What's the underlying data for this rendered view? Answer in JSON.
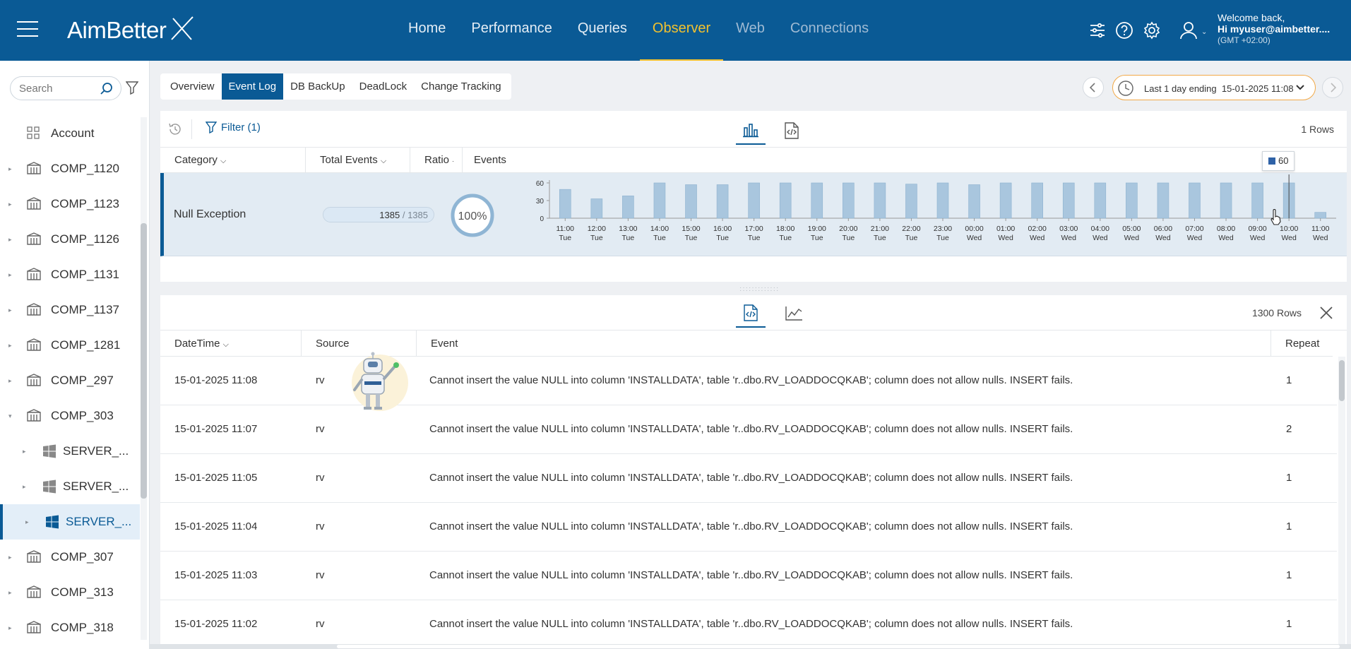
{
  "header": {
    "brand": "AimBetter",
    "nav": [
      {
        "label": "Home",
        "state": "normal"
      },
      {
        "label": "Performance",
        "state": "normal"
      },
      {
        "label": "Queries",
        "state": "normal"
      },
      {
        "label": "Observer",
        "state": "active"
      },
      {
        "label": "Web",
        "state": "dim"
      },
      {
        "label": "Connections",
        "state": "dim"
      }
    ],
    "user": {
      "welcome": "Welcome back,",
      "name": "Hi myuser@aimbetter....",
      "timezone": "(GMT +02:00)"
    }
  },
  "sidebar": {
    "search_placeholder": "Search",
    "items": [
      {
        "label": "Account",
        "icon": "grid-icon",
        "level": 0,
        "caret": ""
      },
      {
        "label": "COMP_1120",
        "icon": "building-icon",
        "level": 0,
        "caret": "▸"
      },
      {
        "label": "COMP_1123",
        "icon": "building-icon",
        "level": 0,
        "caret": "▸"
      },
      {
        "label": "COMP_1126",
        "icon": "building-icon",
        "level": 0,
        "caret": "▸"
      },
      {
        "label": "COMP_1131",
        "icon": "building-icon",
        "level": 0,
        "caret": "▸"
      },
      {
        "label": "COMP_1137",
        "icon": "building-icon",
        "level": 0,
        "caret": "▸"
      },
      {
        "label": "COMP_1281",
        "icon": "building-icon",
        "level": 0,
        "caret": "▸"
      },
      {
        "label": "COMP_297",
        "icon": "building-icon",
        "level": 0,
        "caret": "▸"
      },
      {
        "label": "COMP_303",
        "icon": "building-icon",
        "level": 0,
        "caret": "▾"
      },
      {
        "label": "SERVER_...",
        "icon": "windows-icon",
        "level": 1,
        "caret": "▸"
      },
      {
        "label": "SERVER_...",
        "icon": "windows-icon",
        "level": 1,
        "caret": "▸"
      },
      {
        "label": "SERVER_...",
        "icon": "windows-icon",
        "level": 1,
        "caret": "▸",
        "selected": true
      },
      {
        "label": "COMP_307",
        "icon": "building-icon",
        "level": 0,
        "caret": "▸"
      },
      {
        "label": "COMP_313",
        "icon": "building-icon",
        "level": 0,
        "caret": "▸"
      },
      {
        "label": "COMP_318",
        "icon": "building-icon",
        "level": 0,
        "caret": "▸"
      }
    ]
  },
  "subtabs": [
    {
      "label": "Overview",
      "active": false
    },
    {
      "label": "Event Log",
      "active": true
    },
    {
      "label": "DB BackUp",
      "active": false
    },
    {
      "label": "DeadLock",
      "active": false
    },
    {
      "label": "Change Tracking",
      "active": false
    }
  ],
  "time_range": {
    "label": "Last 1 day ending",
    "value": "15-01-2025 11:08"
  },
  "upper": {
    "filter_label": "Filter (1)",
    "rows_count": "1 Rows",
    "columns": {
      "category": "Category",
      "total": "Total Events",
      "ratio": "Ratio",
      "events": "Events"
    },
    "row": {
      "category": "Null Exception",
      "total": "1385",
      "total_max": "/ 1385",
      "total_fraction": 1.0,
      "ratio": "100%",
      "ratio_fraction": 1.0
    },
    "tooltip_value": "60"
  },
  "chart_data": {
    "type": "bar",
    "xlabel": "",
    "ylabel": "",
    "ylim": [
      0,
      60
    ],
    "yticks": [
      "60",
      "30",
      "0"
    ],
    "bar_color": "#a9c6de",
    "categories": [
      {
        "time": "11:00",
        "day": "Tue"
      },
      {
        "time": "12:00",
        "day": "Tue"
      },
      {
        "time": "13:00",
        "day": "Tue"
      },
      {
        "time": "14:00",
        "day": "Tue"
      },
      {
        "time": "15:00",
        "day": "Tue"
      },
      {
        "time": "16:00",
        "day": "Tue"
      },
      {
        "time": "17:00",
        "day": "Tue"
      },
      {
        "time": "18:00",
        "day": "Tue"
      },
      {
        "time": "19:00",
        "day": "Tue"
      },
      {
        "time": "20:00",
        "day": "Tue"
      },
      {
        "time": "21:00",
        "day": "Tue"
      },
      {
        "time": "22:00",
        "day": "Tue"
      },
      {
        "time": "23:00",
        "day": "Tue"
      },
      {
        "time": "00:00",
        "day": "Wed"
      },
      {
        "time": "01:00",
        "day": "Wed"
      },
      {
        "time": "02:00",
        "day": "Wed"
      },
      {
        "time": "03:00",
        "day": "Wed"
      },
      {
        "time": "04:00",
        "day": "Wed"
      },
      {
        "time": "05:00",
        "day": "Wed"
      },
      {
        "time": "06:00",
        "day": "Wed"
      },
      {
        "time": "07:00",
        "day": "Wed"
      },
      {
        "time": "08:00",
        "day": "Wed"
      },
      {
        "time": "09:00",
        "day": "Wed"
      },
      {
        "time": "10:00",
        "day": "Wed"
      },
      {
        "time": "11:00",
        "day": "Wed"
      }
    ],
    "values": [
      49,
      33,
      38,
      60,
      57,
      57,
      60,
      60,
      60,
      60,
      60,
      58,
      60,
      57,
      60,
      60,
      60,
      60,
      60,
      60,
      60,
      60,
      60,
      60,
      10
    ]
  },
  "lower": {
    "rows_count": "1300 Rows",
    "columns": {
      "datetime": "DateTime",
      "source": "Source",
      "event": "Event",
      "repeat": "Repeat"
    },
    "rows": [
      {
        "datetime": "15-01-2025 11:08",
        "source": "rv",
        "event": "Cannot insert the value NULL into column 'INSTALLDATA', table 'r..dbo.RV_LOADDOCQKAB'; column does not allow nulls. INSERT fails.",
        "repeat": "1"
      },
      {
        "datetime": "15-01-2025 11:07",
        "source": "rv",
        "event": "Cannot insert the value NULL into column 'INSTALLDATA', table 'r..dbo.RV_LOADDOCQKAB'; column does not allow nulls. INSERT fails.",
        "repeat": "2"
      },
      {
        "datetime": "15-01-2025 11:05",
        "source": "rv",
        "event": "Cannot insert the value NULL into column 'INSTALLDATA', table 'r..dbo.RV_LOADDOCQKAB'; column does not allow nulls. INSERT fails.",
        "repeat": "1"
      },
      {
        "datetime": "15-01-2025 11:04",
        "source": "rv",
        "event": "Cannot insert the value NULL into column 'INSTALLDATA', table 'r..dbo.RV_LOADDOCQKAB'; column does not allow nulls. INSERT fails.",
        "repeat": "1"
      },
      {
        "datetime": "15-01-2025 11:03",
        "source": "rv",
        "event": "Cannot insert the value NULL into column 'INSTALLDATA', table 'r..dbo.RV_LOADDOCQKAB'; column does not allow nulls. INSERT fails.",
        "repeat": "1"
      },
      {
        "datetime": "15-01-2025 11:02",
        "source": "rv",
        "event": "Cannot insert the value NULL into column 'INSTALLDATA', table 'r..dbo.RV_LOADDOCQKAB'; column does not allow nulls. INSERT fails.",
        "repeat": "1"
      }
    ]
  },
  "colors": {
    "brand": "#0a5a95",
    "accent": "#f2c12e",
    "time_border": "#f2a947"
  }
}
